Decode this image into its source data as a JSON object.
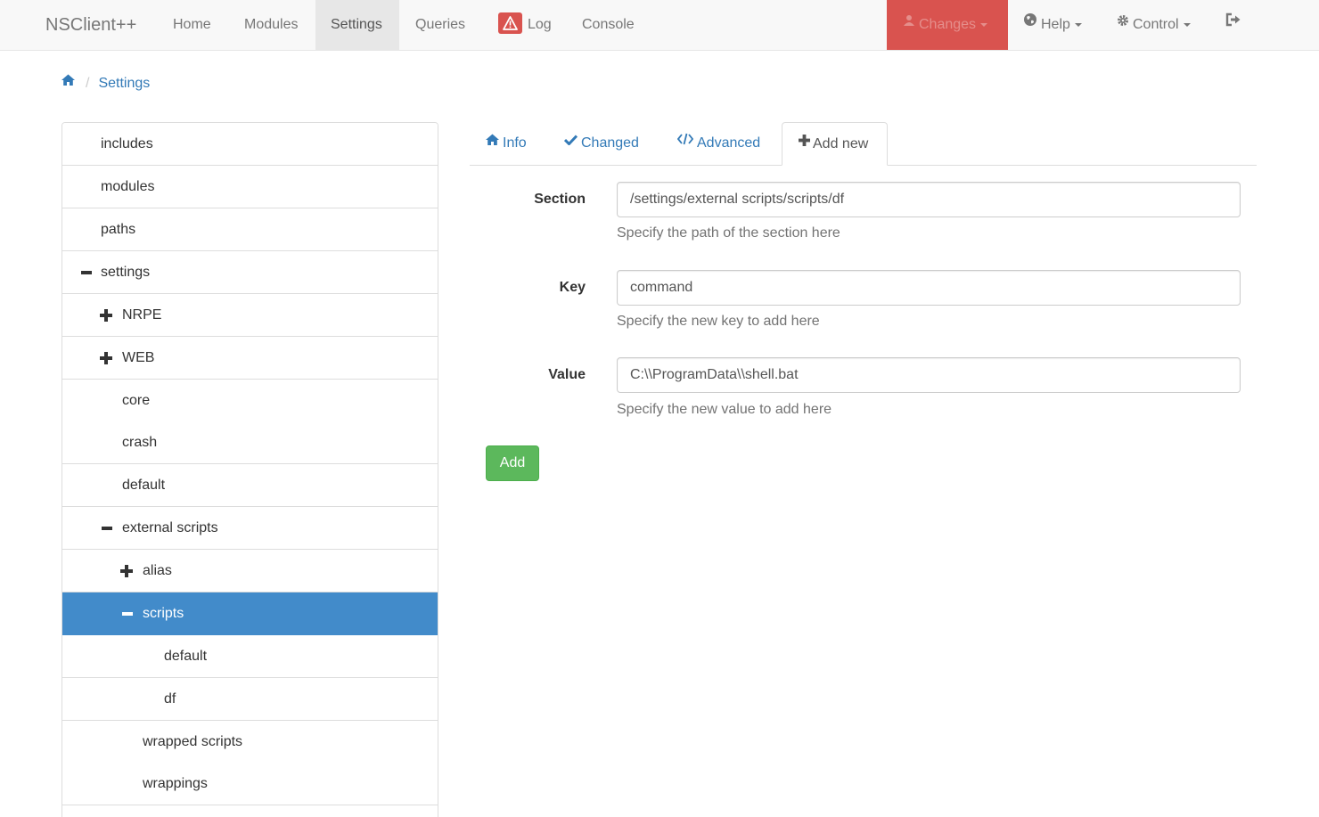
{
  "navbar": {
    "brand": "NSClient++",
    "items": [
      "Home",
      "Modules",
      "Settings",
      "Queries",
      "Log",
      "Console"
    ],
    "changes_label": "Changes",
    "help_label": "Help",
    "control_label": "Control",
    "icons": {
      "log": "warning-icon",
      "changes": "user-icon",
      "help": "globe-icon",
      "control": "gear-icon",
      "logout": "logout-icon"
    },
    "changes_color": "#d9534f"
  },
  "breadcrumb": {
    "items": [
      "Settings"
    ],
    "icon": "home-icon"
  },
  "tree": {
    "items": [
      {
        "label": "includes",
        "toggle": "none"
      },
      {
        "label": "modules",
        "toggle": "none"
      },
      {
        "label": "paths",
        "toggle": "none"
      },
      {
        "label": "settings",
        "toggle": "minus"
      },
      {
        "label": "NRPE",
        "toggle": "plus"
      },
      {
        "label": "WEB",
        "toggle": "plus"
      },
      {
        "label": "core",
        "toggle": "none"
      },
      {
        "label": "crash",
        "toggle": "none"
      },
      {
        "label": "default",
        "toggle": "none"
      },
      {
        "label": "external scripts",
        "toggle": "minus"
      },
      {
        "label": "alias",
        "toggle": "plus"
      },
      {
        "label": "scripts",
        "toggle": "minus",
        "selected": true
      },
      {
        "label": "default",
        "toggle": "none"
      },
      {
        "label": "df",
        "toggle": "none"
      },
      {
        "label": "wrapped scripts",
        "toggle": "none"
      },
      {
        "label": "wrappings",
        "toggle": "none"
      }
    ],
    "selected_color": "#428bca"
  },
  "tabs": {
    "items": [
      "Info",
      "Changed",
      "Advanced",
      "Add new"
    ],
    "active": "Add new",
    "icons": [
      "home-icon",
      "check-icon",
      "code-icon",
      "plus-icon"
    ]
  },
  "form": {
    "section": {
      "label": "Section",
      "value": "/settings/external scripts/scripts/df",
      "help": "Specify the path of the section here"
    },
    "key": {
      "label": "Key",
      "value": "command",
      "help": "Specify the new key to add here"
    },
    "value": {
      "label": "Value",
      "value": "C:\\\\ProgramData\\\\shell.bat",
      "help": "Specify the new value to add here"
    },
    "add_label": "Add",
    "add_color": "#5cb85c"
  }
}
